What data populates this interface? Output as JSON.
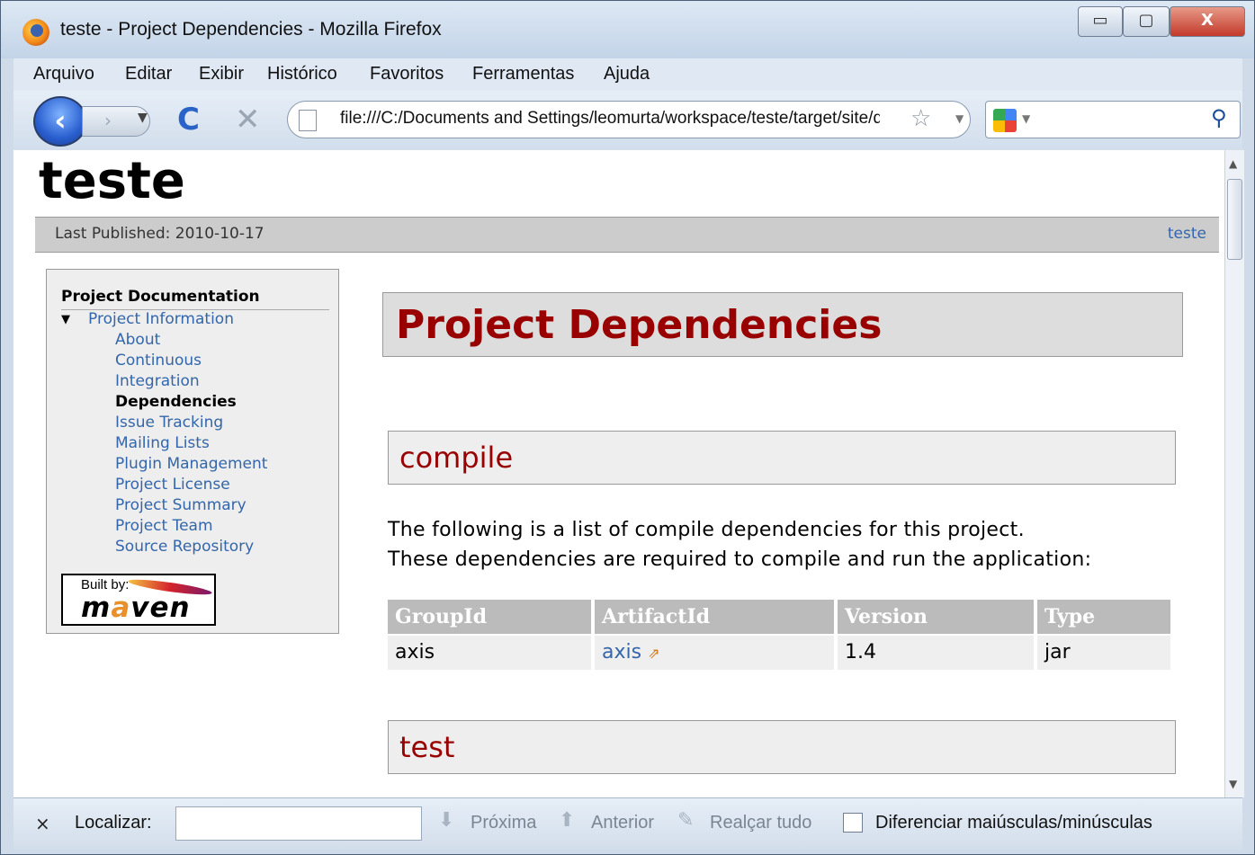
{
  "window": {
    "title": "teste - Project Dependencies - Mozilla Firefox",
    "min_label": "▭",
    "max_label": "▢",
    "close_label": "X"
  },
  "menu": [
    "Arquivo",
    "Editar",
    "Exibir",
    "Histórico",
    "Favoritos",
    "Ferramentas",
    "Ajuda"
  ],
  "nav": {
    "url": "file:///C:/Documents and Settings/leomurta/workspace/teste/target/site/dependencies.html",
    "back_glyph": "‹",
    "forward_glyph": "›",
    "reload_glyph": "C",
    "stop_glyph": "✕",
    "star_glyph": "☆",
    "search_glyph": "⚲"
  },
  "site": {
    "title": "teste",
    "last_published": "Last Published: 2010-10-17",
    "project_link": "teste"
  },
  "sidebar": {
    "heading": "Project Documentation",
    "section": "Project Information",
    "items": [
      "About",
      "Continuous",
      "Integration",
      "Dependencies",
      "Issue Tracking",
      "Mailing Lists",
      "Plugin Management",
      "Project License",
      "Project Summary",
      "Project Team",
      "Source Repository"
    ],
    "built_by": "Built by:",
    "maven_logo": "maven"
  },
  "main": {
    "heading": "Project Dependencies",
    "compile_heading": "compile",
    "compile_text_1": "The following is a list of compile dependencies for this project.",
    "compile_text_2": "These dependencies are required to compile and run the application:",
    "columns": [
      "GroupId",
      "ArtifactId",
      "Version",
      "Type"
    ],
    "rows": [
      {
        "group": "axis",
        "artifact": "axis",
        "version": "1.4",
        "type": "jar"
      }
    ],
    "test_heading": "test"
  },
  "findbar": {
    "close": "×",
    "label": "Localizar:",
    "next": "Próxima",
    "previous": "Anterior",
    "highlight": "Realçar tudo",
    "match_case": "Diferenciar maiúsculas/minúsculas"
  }
}
